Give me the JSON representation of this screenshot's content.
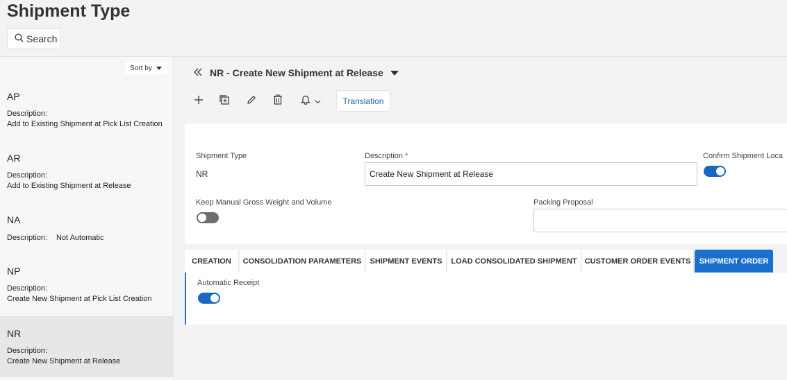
{
  "page": {
    "title": "Shipment Type",
    "search_label": "Search"
  },
  "list": {
    "sort_label": "Sort by",
    "items": [
      {
        "code": "AP",
        "desc_label": "Description:",
        "desc": "Add to Existing Shipment at Pick List Creation"
      },
      {
        "code": "AR",
        "desc_label": "Description:",
        "desc": "Add to Existing Shipment at Release"
      },
      {
        "code": "NA",
        "desc_label": "Description:",
        "desc": "Not Automatic"
      },
      {
        "code": "NP",
        "desc_label": "Description:",
        "desc": "Create New Shipment at Pick List Creation"
      },
      {
        "code": "NR",
        "desc_label": "Description:",
        "desc": "Create New Shipment at Release"
      }
    ]
  },
  "record": {
    "title": "NR - Create New Shipment at Release"
  },
  "toolbar": {
    "icons": [
      "plus-icon",
      "duplicate-icon",
      "edit-icon",
      "delete-icon",
      "bell-icon"
    ],
    "translation_label": "Translation"
  },
  "form": {
    "shipment_type_label": "Shipment Type",
    "shipment_type_value": "NR",
    "description_label": "Description",
    "required_mark": "*",
    "description_value": "Create New Shipment at Release",
    "confirm_label": "Confirm Shipment Loca",
    "confirm_on": true,
    "keep_manual_label": "Keep Manual Gross Weight and Volume",
    "keep_manual_on": false,
    "packing_label": "Packing Proposal",
    "packing_value": ""
  },
  "tabs": [
    "CREATION",
    "CONSOLIDATION PARAMETERS",
    "SHIPMENT EVENTS",
    "LOAD CONSOLIDATED SHIPMENT",
    "CUSTOMER ORDER EVENTS",
    "SHIPMENT ORDER"
  ],
  "active_tab": "SHIPMENT ORDER",
  "tab_content": {
    "automatic_receipt_label": "Automatic Receipt",
    "automatic_receipt_on": true
  },
  "colors": {
    "accent": "#1a6fcf",
    "toggle_on": "#1868c0",
    "selected_row": "#e7e6e9",
    "link": "#1a62b5"
  }
}
